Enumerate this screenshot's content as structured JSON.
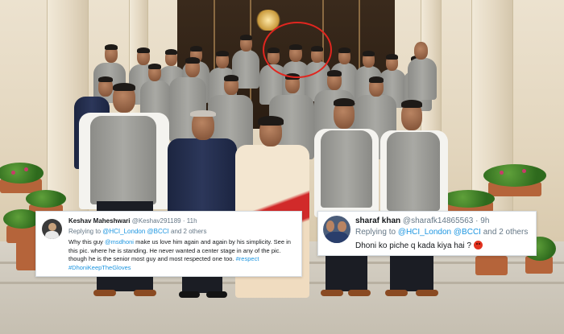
{
  "scene": {
    "description_icon": "group-photo",
    "highlight_color": "#e0261f"
  },
  "tweet_left": {
    "name": "Keshav Maheshwari",
    "handle": "@Keshav291189",
    "dot": "·",
    "time": "11h",
    "replying_prefix": "Replying to ",
    "mention1": "@HCI_London",
    "mention2": "@BCCI",
    "replying_suffix": " and 2 others",
    "body_1": "Why this guy ",
    "body_mention": "@msdhoni",
    "body_2": " make us love him again and again by his simplicity. See in this pic. where he is standing. He never wanted a center stage in any of the pic. though he is the senior most guy and most respected one too. ",
    "hashtag1": "#respect",
    "hashtag2": "#DhoniKeepTheGloves"
  },
  "tweet_right": {
    "name": "sharaf khan",
    "handle": "@sharafk14865563",
    "dot": "·",
    "time": "9h",
    "replying_prefix": "Replying to ",
    "mention1": "@HCI_London",
    "mention2": "@BCCI",
    "replying_suffix": " and 2 others",
    "body": "Dhoni ko piche q kada kiya hai ?",
    "emoji": "angry-face-emoji"
  },
  "colors": {
    "link": "#1b95e0",
    "text": "#14171a",
    "muted": "#657786"
  }
}
